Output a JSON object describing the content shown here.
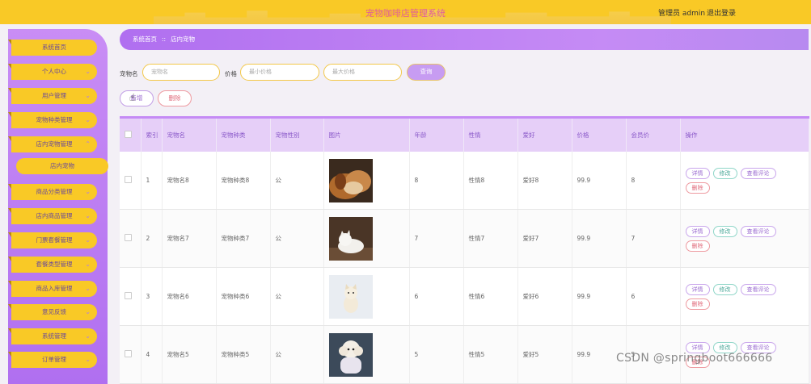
{
  "header": {
    "title": "宠物咖啡店管理系统",
    "user_text": "管理员 admin",
    "logout_label": "退出登录",
    "bg_color": "#f9c926"
  },
  "sidebar": {
    "items": [
      {
        "label": "系统首页"
      },
      {
        "label": "个人中心",
        "arrow": "⌄"
      },
      {
        "label": "用户管理",
        "arrow": "⌄"
      },
      {
        "label": "宠物种类管理",
        "arrow": "⌄"
      },
      {
        "label": "店内宠物管理",
        "arrow": "⌃"
      },
      {
        "label": "店内宠物"
      },
      {
        "label": "商品分类管理",
        "arrow": "⌄"
      },
      {
        "label": "店内商品管理",
        "arrow": "⌄"
      },
      {
        "label": "门票套餐管理",
        "arrow": "⌄"
      },
      {
        "label": "套餐类型管理",
        "arrow": "⌄"
      },
      {
        "label": "商品入库管理",
        "arrow": "⌄"
      },
      {
        "label": "意见反馈",
        "arrow": "⌄"
      },
      {
        "label": "系统管理",
        "arrow": "⌄"
      },
      {
        "label": "订单管理",
        "arrow": "⌄"
      }
    ]
  },
  "breadcrumb": {
    "home": "系统首页",
    "separator": "::",
    "current": "店内宠物"
  },
  "search": {
    "name_label": "宠物名",
    "name_placeholder": "宠物名",
    "price_label": "价格",
    "min_placeholder": "最小价格",
    "max_placeholder": "最大价格",
    "search_label": "查询"
  },
  "actions": {
    "add_label": "新增",
    "delete_label": "删除"
  },
  "table": {
    "headers": [
      "索引",
      "宠物名",
      "宠物种类",
      "宠物性别",
      "图片",
      "年龄",
      "性情",
      "爱好",
      "价格",
      "会员价",
      "操作"
    ],
    "rows": [
      {
        "index": "1",
        "name": "宠物名8",
        "kind": "宠物种类8",
        "gender": "公",
        "age": "8",
        "temper": "性情8",
        "hobby": "爱好8",
        "price": "99.9",
        "member_price": "8"
      },
      {
        "index": "2",
        "name": "宠物名7",
        "kind": "宠物种类7",
        "gender": "公",
        "age": "7",
        "temper": "性情7",
        "hobby": "爱好7",
        "price": "99.9",
        "member_price": "7"
      },
      {
        "index": "3",
        "name": "宠物名6",
        "kind": "宠物种类6",
        "gender": "公",
        "age": "6",
        "temper": "性情6",
        "hobby": "爱好6",
        "price": "99.9",
        "member_price": "6"
      },
      {
        "index": "4",
        "name": "宠物名5",
        "kind": "宠物种类5",
        "gender": "公",
        "age": "5",
        "temper": "性情5",
        "hobby": "爱好5",
        "price": "99.9",
        "member_price": "5"
      }
    ],
    "row_buttons": {
      "detail": "详情",
      "edit": "修改",
      "comment": "查看评论",
      "remove": "删除"
    }
  },
  "watermark": "CSDN @springboot666666",
  "colors": {
    "accent_purple": "#b06ff0",
    "accent_yellow": "#f9c926",
    "danger": "#e06a7a",
    "teal": "#4aa898"
  }
}
